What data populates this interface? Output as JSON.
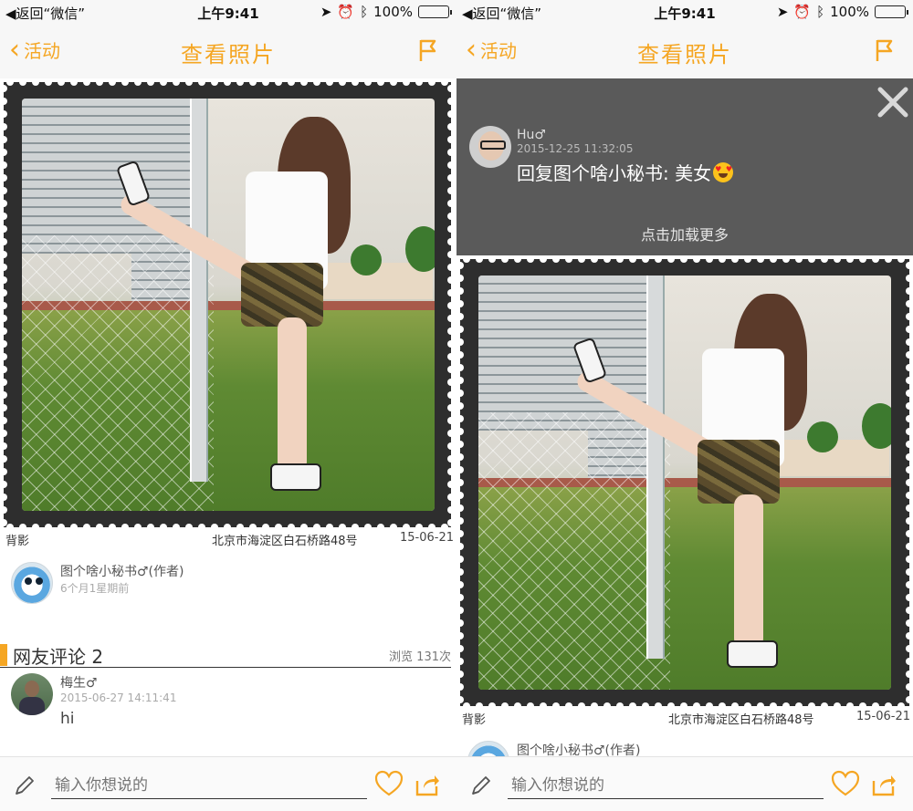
{
  "status_bar": {
    "back_app": "◀返回“微信”",
    "time": "上午9:41",
    "battery": "100%"
  },
  "nav": {
    "back_label": "活动",
    "title": "查看照片"
  },
  "photo": {
    "caption_left": "背影",
    "location": "北京市海淀区白石桥路48号",
    "date": "15-06-21"
  },
  "author": {
    "name": "图个啥小秘书♂(作者)",
    "name_short": "图个啥小秘书♂(作者)",
    "relative_time": "6个月1星期前"
  },
  "comments": {
    "title": "网友评论 2",
    "views": "浏览 131次",
    "items": [
      {
        "user": "梅生♂",
        "time": "2015-06-27 14:11:41",
        "text": "hi"
      }
    ]
  },
  "overlay": {
    "user": "Hu♂",
    "time": "2015-12-25 11:32:05",
    "text": "回复图个啥小秘书: 美女",
    "load_more": "点击加载更多"
  },
  "bottom": {
    "input_placeholder": "输入你想说的"
  },
  "colors": {
    "accent": "#f5a623",
    "stamp": "#2e2e2e",
    "overlay": "#5a5a5a"
  },
  "icons": [
    "back-chevron-icon",
    "flag-icon",
    "pencil-icon",
    "heart-icon",
    "share-icon",
    "close-icon",
    "location-arrow-icon",
    "alarm-icon",
    "bluetooth-icon",
    "battery-icon"
  ]
}
